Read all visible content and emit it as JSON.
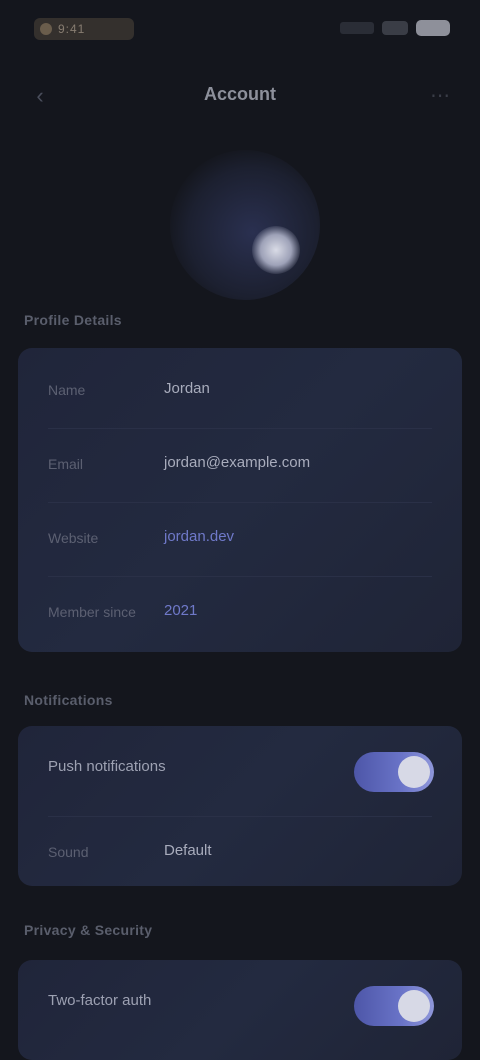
{
  "status_bar": {
    "time": "9:41"
  },
  "nav": {
    "title": "Account"
  },
  "sections": {
    "profile_label": "Profile Details",
    "notifications_label": "Notifications",
    "privacy_label": "Privacy & Security"
  },
  "profile": {
    "rows": [
      {
        "key": "Name",
        "value": "Jordan"
      },
      {
        "key": "Email",
        "value": "jordan@example.com"
      },
      {
        "key": "Website",
        "value": "jordan.dev"
      },
      {
        "key": "Member since",
        "value": "2021"
      }
    ]
  },
  "notifications": {
    "toggle_label": "Push notifications",
    "toggle_on": true,
    "select_key": "Sound",
    "select_value": "Default"
  },
  "privacy": {
    "toggle_label": "Two-factor auth",
    "toggle_on": true
  },
  "colors": {
    "background": "#14161d",
    "card": "#222840",
    "accent": "#6a74c8"
  },
  "icons": {
    "back": "chevron-left-icon",
    "more": "more-icon",
    "avatar": "avatar"
  }
}
